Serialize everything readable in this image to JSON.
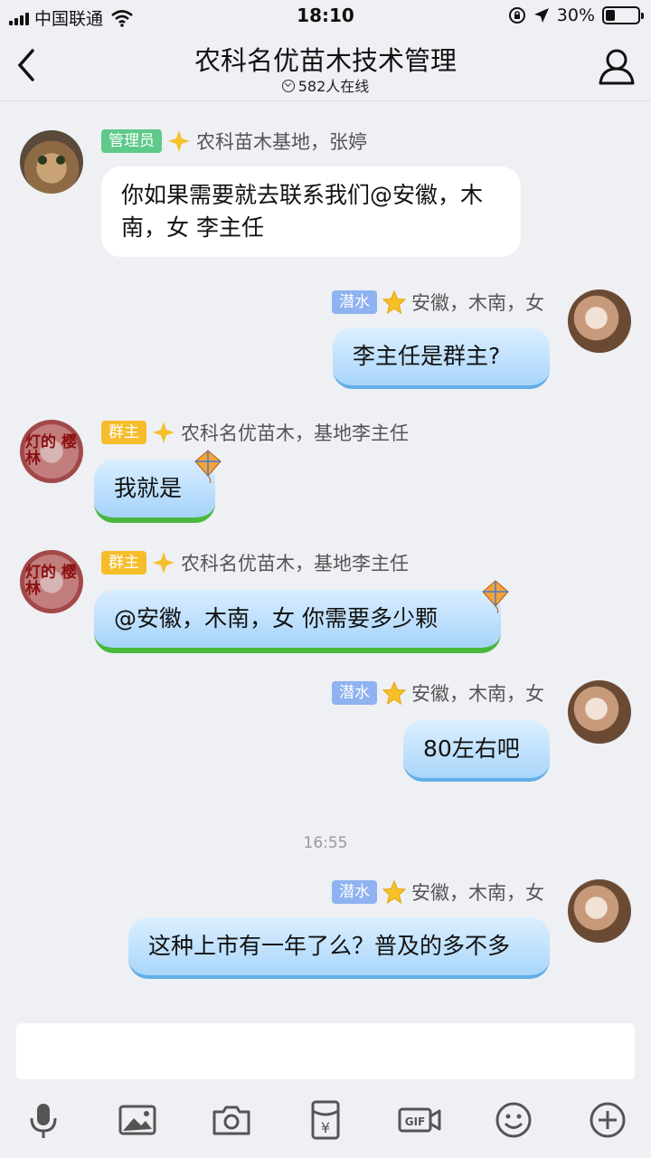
{
  "status_bar": {
    "carrier": "中国联通",
    "time": "18:10",
    "battery_text": "30%",
    "battery_level": 0.3
  },
  "header": {
    "title": "农科名优苗木技术管理",
    "online_count": "582人在线"
  },
  "messages": [
    {
      "badge": "管理员",
      "sender": "农科苗木基地，张婷",
      "text": "你如果需要就去联系我们@安徽，木南，女 李主任"
    },
    {
      "badge": "潜水",
      "sender": "安徽，木南，女",
      "text": "李主任是群主?"
    },
    {
      "badge": "群主",
      "sender": "农科名优苗木，基地李主任",
      "text": "我就是"
    },
    {
      "badge": "群主",
      "sender": "农科名优苗木，基地李主任",
      "text": "@安徽，木南，女 你需要多少颗"
    },
    {
      "badge": "潜水",
      "sender": "安徽，木南，女",
      "text": "80左右吧"
    },
    {
      "badge": "潜水",
      "sender": "安徽，木南，女",
      "text": "这种上市有一年了么？普及的多不多"
    }
  ],
  "timestamp": "16:55",
  "avatar_text": "灯的 樱林",
  "toolbar": [
    "voice-icon",
    "image-icon",
    "camera-icon",
    "red-packet-icon",
    "gif-icon",
    "emoji-icon",
    "plus-icon"
  ],
  "colors": {
    "admin_badge": "#5fc98a",
    "owner_badge": "#f6bd2b",
    "lurk_badge": "#8fb2f0",
    "bubble_blue": "#a9d6fb"
  }
}
